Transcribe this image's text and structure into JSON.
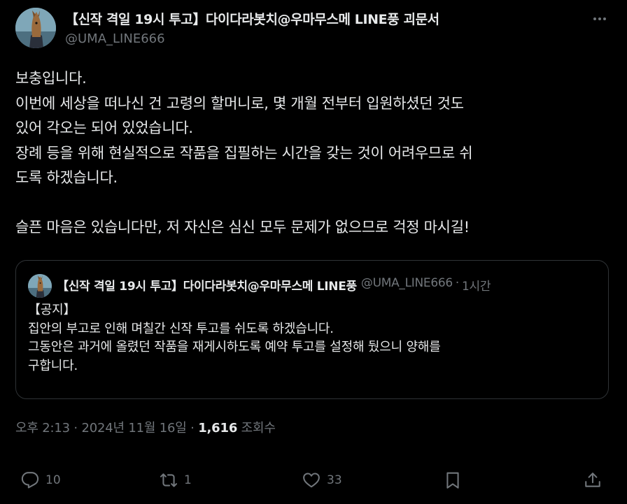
{
  "author": {
    "name": "【신작 격일 19시 투고】다이다라봇치@우마무스메 LINE풍 괴문서",
    "handle": "@UMA_LINE666"
  },
  "tweet_lines": [
    "보충입니다.",
    "이번에 세상을 떠나신 건 고령의 할머니로, 몇 개월 전부터 입원하셨던 것도",
    "있어 각오는 되어 있었습니다.",
    "장례 등을 위해 현실적으로 작품을 집필하는 시간을 갖는 것이 어려우므로 쉬",
    "도록 하겠습니다.",
    "",
    "슬픈 마음은 있습니다만, 저 자신은 심신 모두 문제가 없으므로 걱정 마시길!"
  ],
  "quote": {
    "name": "【신작 격일 19시 투고】다이다라봇치@우마무스메 LINE풍",
    "handle": "@UMA_LINE666",
    "separator": "·",
    "time": "1시간",
    "body_lines": [
      "【공지】",
      "집안의 부고로 인해 며칠간 신작 투고를 쉬도록 하겠습니다.",
      "그동안은 과거에 올렸던 작품을 재게시하도록 예약 투고를 설정해 뒀으니 양해를",
      "구합니다."
    ]
  },
  "meta": {
    "time": "오후 2:13",
    "separator": "·",
    "date": "2024년 11월 16일",
    "views_count": "1,616",
    "views_label": "조회수"
  },
  "actions": {
    "reply_count": "10",
    "repost_count": "1",
    "like_count": "33"
  },
  "colors": {
    "background": "#000000",
    "text": "#e7e9ea",
    "secondary": "#71767b",
    "border": "#2f3336"
  }
}
